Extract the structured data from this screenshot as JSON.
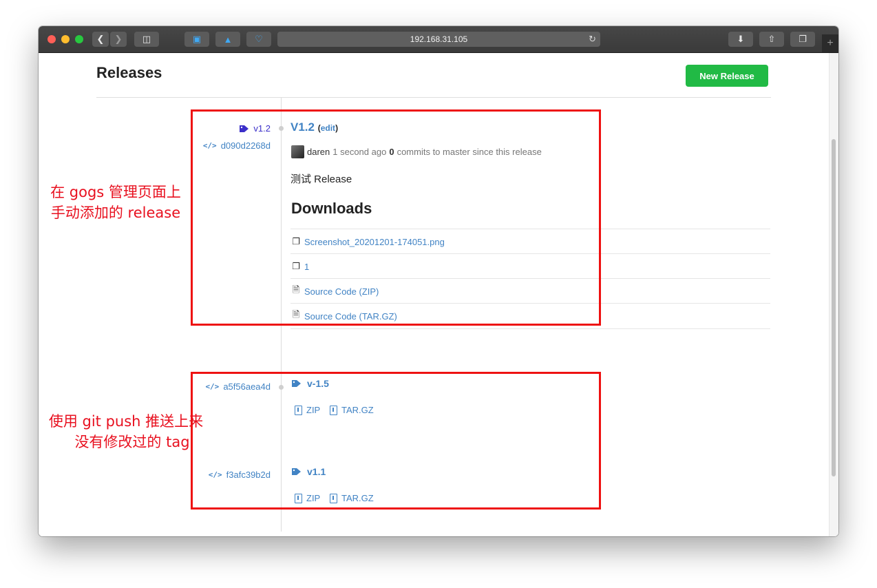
{
  "browser": {
    "address": "192.168.31.105",
    "colors": {
      "close": "#ff5f57",
      "minimize": "#ffbd2e",
      "zoom": "#28c840"
    }
  },
  "page": {
    "title": "Releases",
    "new_release_label": "New Release"
  },
  "releases": [
    {
      "tag": "v1.2",
      "commit": "d090d2268d",
      "title": "V1.2",
      "edit_open": "(",
      "edit_label": "edit",
      "edit_close": ")",
      "author": "daren",
      "time": "1 second ago",
      "commits_count": "0",
      "commits_text": "commits to master since this release",
      "note": "测试 Release",
      "downloads_heading": "Downloads",
      "downloads": [
        {
          "icon": "package-icon",
          "label": "Screenshot_20201201-174051.png"
        },
        {
          "icon": "package-icon",
          "label": "1"
        },
        {
          "icon": "file-zip-icon",
          "label": "Source Code (ZIP)"
        },
        {
          "icon": "file-zip-icon",
          "label": "Source Code (TAR.GZ)"
        }
      ]
    }
  ],
  "tags": [
    {
      "commit": "a5f56aea4d",
      "name": "v-1.5",
      "zip": "ZIP",
      "targz": "TAR.GZ"
    },
    {
      "commit": "f3afc39b2d",
      "name": "v1.1",
      "zip": "ZIP",
      "targz": "TAR.GZ"
    }
  ],
  "annotations": {
    "top_line1": "在 gogs 管理页面上",
    "top_line2": "手动添加的 release",
    "bottom_line1": "使用 git push 推送上来",
    "bottom_line2": "没有修改过的 tag"
  },
  "accent": {
    "link": "#4183c4",
    "green": "#21ba45",
    "annotation": "#ee1111"
  }
}
